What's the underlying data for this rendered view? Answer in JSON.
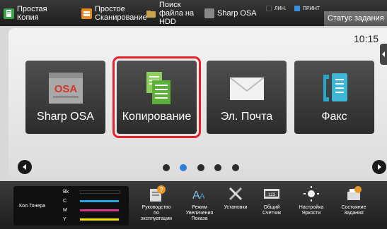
{
  "shortcuts": [
    {
      "label": "Простая Копия",
      "icon": "simple-copy-icon"
    },
    {
      "label": "Простое Сканирование",
      "icon": "simple-scan-icon"
    },
    {
      "label": "Поиск файла на HDD",
      "icon": "hdd-file-search-icon"
    },
    {
      "label": "Sharp OSA",
      "icon": "sharp-osa-icon"
    }
  ],
  "indicators": {
    "line": "ЛИН.",
    "print": "ПРИНТ"
  },
  "status_button": "Статус задания",
  "clock": "10:15",
  "tiles": [
    {
      "label": "Sharp OSA",
      "icon": "sharp-osa-icon",
      "art_text": "OSA"
    },
    {
      "label": "Копирование",
      "icon": "copy-icon"
    },
    {
      "label": "Эл. Почта",
      "icon": "email-icon"
    },
    {
      "label": "Факс",
      "icon": "fax-icon"
    }
  ],
  "pagination": {
    "pages": 5,
    "current": 2
  },
  "toner": {
    "label": "Кол.Тонера",
    "rows": [
      {
        "name": "Bk",
        "color": "#111111"
      },
      {
        "name": "C",
        "color": "#29a8df"
      },
      {
        "name": "M",
        "color": "#d13b8f"
      },
      {
        "name": "Y",
        "color": "#f2e600"
      }
    ]
  },
  "functions": [
    {
      "label": "Руководство по эксплуатации",
      "icon": "manual-icon"
    },
    {
      "label": "Режим Увеличения Показа",
      "icon": "zoom-display-icon"
    },
    {
      "label": "Установки",
      "icon": "settings-icon"
    },
    {
      "label": "Общий Счетчик",
      "icon": "counter-icon"
    },
    {
      "label": "Настройка Яркости",
      "icon": "brightness-icon"
    },
    {
      "label": "Состояние Задания",
      "icon": "job-status-icon"
    }
  ]
}
